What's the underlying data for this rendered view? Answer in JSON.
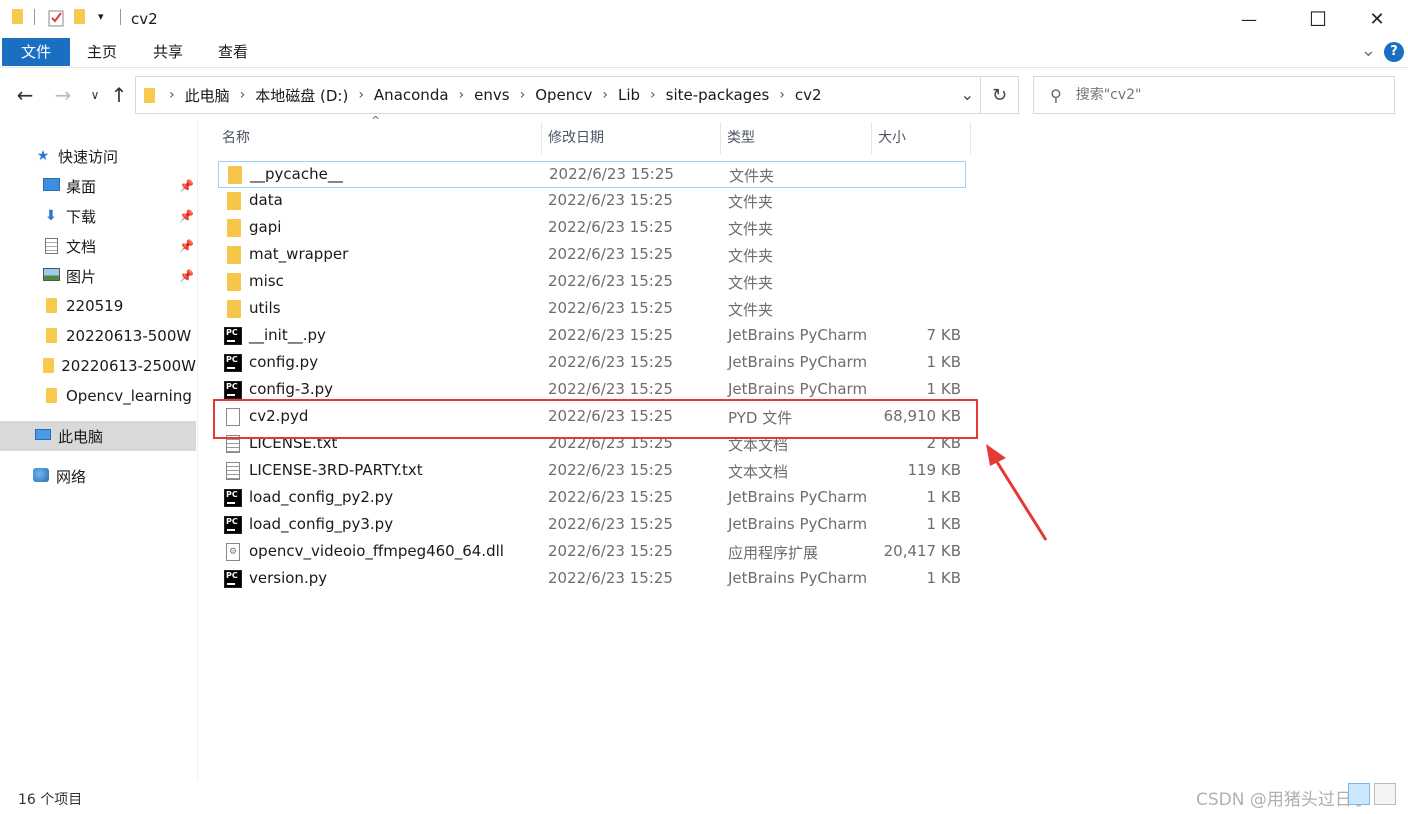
{
  "window": {
    "title": "cv2",
    "minimize": "—",
    "maximize": "☐",
    "close": "✕"
  },
  "ribbon": {
    "tabs": [
      "文件",
      "主页",
      "共享",
      "查看"
    ],
    "help": "?"
  },
  "address": {
    "crumbs": [
      "此电脑",
      "本地磁盘 (D:)",
      "Anaconda",
      "envs",
      "Opencv",
      "Lib",
      "site-packages",
      "cv2"
    ]
  },
  "search": {
    "placeholder": "搜索\"cv2\""
  },
  "sidebar": {
    "items": [
      {
        "label": "快速访问",
        "icon": "star-icon"
      },
      {
        "label": "桌面",
        "icon": "desktop-icon",
        "pinned": true
      },
      {
        "label": "下载",
        "icon": "download-icon",
        "pinned": true
      },
      {
        "label": "文档",
        "icon": "document-icon",
        "pinned": true
      },
      {
        "label": "图片",
        "icon": "picture-icon",
        "pinned": true
      },
      {
        "label": "220519",
        "icon": "folder-icon"
      },
      {
        "label": "20220613-500W",
        "icon": "folder-icon"
      },
      {
        "label": "20220613-2500W",
        "icon": "folder-icon"
      },
      {
        "label": "Opencv_learning",
        "icon": "folder-icon"
      },
      {
        "label": "此电脑",
        "icon": "computer-icon",
        "selected": true
      },
      {
        "label": "网络",
        "icon": "network-icon"
      }
    ]
  },
  "columns": {
    "name": "名称",
    "date": "修改日期",
    "type": "类型",
    "size": "大小"
  },
  "files": [
    {
      "name": "__pycache__",
      "date": "2022/6/23 15:25",
      "type": "文件夹",
      "size": "",
      "icon": "folder"
    },
    {
      "name": "data",
      "date": "2022/6/23 15:25",
      "type": "文件夹",
      "size": "",
      "icon": "folder"
    },
    {
      "name": "gapi",
      "date": "2022/6/23 15:25",
      "type": "文件夹",
      "size": "",
      "icon": "folder"
    },
    {
      "name": "mat_wrapper",
      "date": "2022/6/23 15:25",
      "type": "文件夹",
      "size": "",
      "icon": "folder"
    },
    {
      "name": "misc",
      "date": "2022/6/23 15:25",
      "type": "文件夹",
      "size": "",
      "icon": "folder"
    },
    {
      "name": "utils",
      "date": "2022/6/23 15:25",
      "type": "文件夹",
      "size": "",
      "icon": "folder"
    },
    {
      "name": "__init__.py",
      "date": "2022/6/23 15:25",
      "type": "JetBrains PyCharm",
      "size": "7 KB",
      "icon": "pycharm"
    },
    {
      "name": "config.py",
      "date": "2022/6/23 15:25",
      "type": "JetBrains PyCharm",
      "size": "1 KB",
      "icon": "pycharm"
    },
    {
      "name": "config-3.py",
      "date": "2022/6/23 15:25",
      "type": "JetBrains PyCharm",
      "size": "1 KB",
      "icon": "pycharm"
    },
    {
      "name": "cv2.pyd",
      "date": "2022/6/23 15:25",
      "type": "PYD 文件",
      "size": "68,910 KB",
      "icon": "file"
    },
    {
      "name": "LICENSE.txt",
      "date": "2022/6/23 15:25",
      "type": "文本文档",
      "size": "2 KB",
      "icon": "txt"
    },
    {
      "name": "LICENSE-3RD-PARTY.txt",
      "date": "2022/6/23 15:25",
      "type": "文本文档",
      "size": "119 KB",
      "icon": "txt"
    },
    {
      "name": "load_config_py2.py",
      "date": "2022/6/23 15:25",
      "type": "JetBrains PyCharm",
      "size": "1 KB",
      "icon": "pycharm"
    },
    {
      "name": "load_config_py3.py",
      "date": "2022/6/23 15:25",
      "type": "JetBrains PyCharm",
      "size": "1 KB",
      "icon": "pycharm"
    },
    {
      "name": "opencv_videoio_ffmpeg460_64.dll",
      "date": "2022/6/23 15:25",
      "type": "应用程序扩展",
      "size": "20,417 KB",
      "icon": "dll"
    },
    {
      "name": "version.py",
      "date": "2022/6/23 15:25",
      "type": "JetBrains PyCharm",
      "size": "1 KB",
      "icon": "pycharm"
    }
  ],
  "status": {
    "count": "16 个项目"
  },
  "watermark": "CSDN @用猪头过日子",
  "colors": {
    "accent": "#1a6fc2",
    "highlight": "#e53935",
    "selected_bg": "#d9d9d9"
  }
}
